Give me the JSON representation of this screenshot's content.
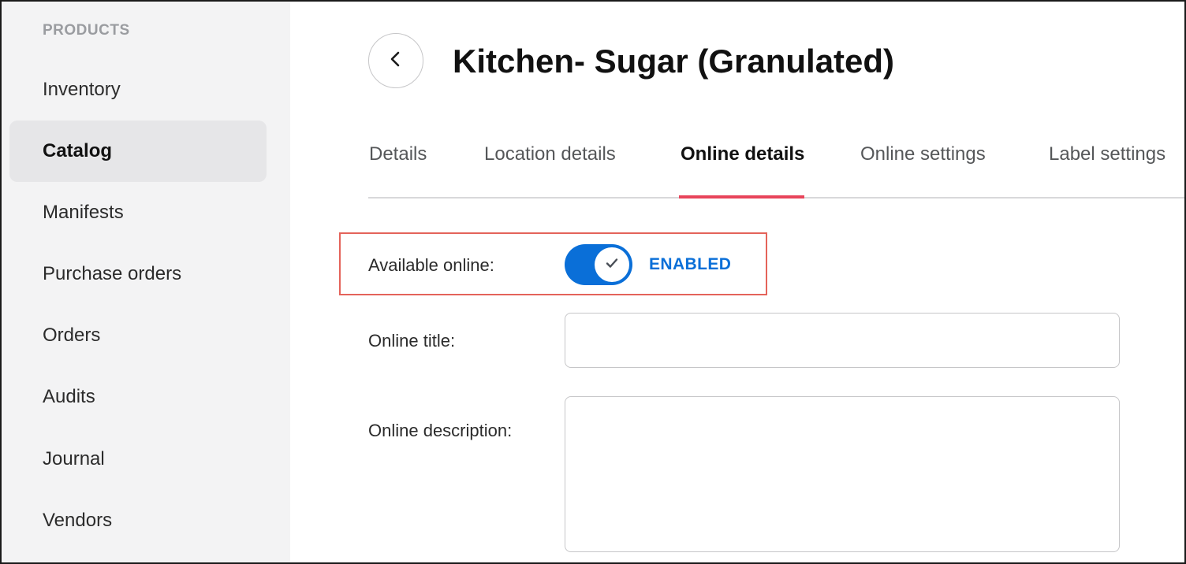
{
  "sidebar": {
    "heading": "PRODUCTS",
    "items": [
      {
        "label": "Inventory"
      },
      {
        "label": "Catalog"
      },
      {
        "label": "Manifests"
      },
      {
        "label": "Purchase orders"
      },
      {
        "label": "Orders"
      },
      {
        "label": "Audits"
      },
      {
        "label": "Journal"
      },
      {
        "label": "Vendors"
      }
    ],
    "active": "Catalog"
  },
  "header": {
    "title": "Kitchen- Sugar (Granulated)",
    "back_icon": "chevron-left-icon"
  },
  "tabs": [
    {
      "label": "Details"
    },
    {
      "label": "Location details"
    },
    {
      "label": "Online details"
    },
    {
      "label": "Online settings"
    },
    {
      "label": "Label settings"
    }
  ],
  "active_tab": "Online details",
  "form": {
    "available_online_label": "Available online:",
    "available_online_enabled": true,
    "available_online_status": "ENABLED",
    "online_title_label": "Online title:",
    "online_title_value": "",
    "online_description_label": "Online description:",
    "online_description_value": ""
  },
  "colors": {
    "accent": "#0a6fd8",
    "tab_underline": "#e8445a",
    "highlight_border": "#e4635a",
    "sidebar_bg": "#f3f3f4",
    "sidebar_active_bg": "#e6e6e8"
  }
}
